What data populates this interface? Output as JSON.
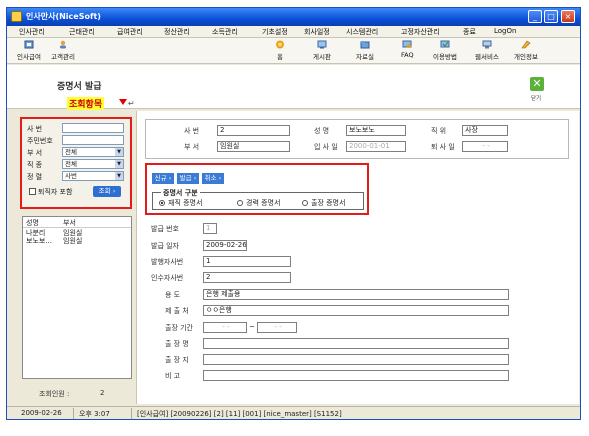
{
  "window": {
    "title": "인사만사(NiceSoft)"
  },
  "menu": [
    "인사관리",
    "근태관리",
    "급여관리",
    "정산관리",
    "소득관리",
    "기초설정",
    "회사일정",
    "시스템관리",
    "고정자산관리",
    "종료",
    "LogOn"
  ],
  "toolbar_left": [
    {
      "label": "인사급여",
      "icon": "payroll-icon"
    },
    {
      "label": "고객관리",
      "icon": "customer-icon"
    }
  ],
  "toolbar_right": [
    {
      "label": "홈",
      "icon": "home-icon"
    },
    {
      "label": "게시판",
      "icon": "board-icon"
    },
    {
      "label": "자료실",
      "icon": "archive-icon"
    },
    {
      "label": "FAQ",
      "icon": "faq-icon"
    },
    {
      "label": "이용방법",
      "icon": "guide-icon"
    },
    {
      "label": "웹서비스",
      "icon": "webservice-icon"
    },
    {
      "label": "개인정보",
      "icon": "personal-icon"
    }
  ],
  "header": {
    "page_title": "증명서 발급",
    "query_items_label": "조회항목",
    "close_label": "닫기"
  },
  "search": {
    "emp_no_label": "사 번",
    "resident_no_label": "주민번호",
    "dept_label": "부 서",
    "dept_value": "전체",
    "job_label": "직 종",
    "job_value": "전체",
    "sort_label": "정 렬",
    "sort_value": "사번",
    "retired_label": "퇴직자 포함",
    "search_button": "조회"
  },
  "employee_list": {
    "headers": [
      "성명",
      "부서"
    ],
    "rows": [
      [
        "나분리",
        "임원실"
      ],
      [
        "보노보...",
        "임원실"
      ]
    ],
    "count_label": "조회인원 :",
    "count_value": "2"
  },
  "info": {
    "emp_no_label": "사 번",
    "emp_no_value": "2",
    "name_label": "성 명",
    "name_value": "보노보노",
    "position_label": "직 위",
    "position_value": "사장",
    "dept_label": "부 서",
    "dept_value": "임원실",
    "join_date_label": "입 사 일",
    "join_date_value": "2000-01-01",
    "leave_date_label": "퇴 사 일",
    "leave_date_value": "- -"
  },
  "actions": [
    "신규",
    "발급",
    "취소"
  ],
  "cert": {
    "legend": "증명서 구분",
    "options": [
      "재직 증명서",
      "경력 증명서",
      "출장 증명서"
    ],
    "selected_index": 0
  },
  "form": {
    "issue_no_label": "발급 번호",
    "issue_no_value": "1",
    "issue_date_label": "발급 일자",
    "issue_date_value": "2009-02-26",
    "issuer_no_label": "발행자사번",
    "issuer_no_value": "1",
    "receiver_no_label": "인수자사번",
    "receiver_no_value": "2",
    "purpose_label": "용 도",
    "purpose_value": "은행 제출용",
    "submit_to_label": "제 출 처",
    "submit_to_value": "ㅇㅇ은행",
    "trip_period_label": "출장 기간",
    "trip_from_value": "- -",
    "trip_tilde": "~",
    "trip_to_value": "- -",
    "trip_place_label": "출 장 명",
    "trip_location_label": "출 장 지",
    "remarks_label": "비 고"
  },
  "status": {
    "date": "2009-02-26",
    "time": "오후 3:07",
    "info": "[인사급여] [20090226] [2] [11] [001] [nice_master] [S1152]"
  }
}
